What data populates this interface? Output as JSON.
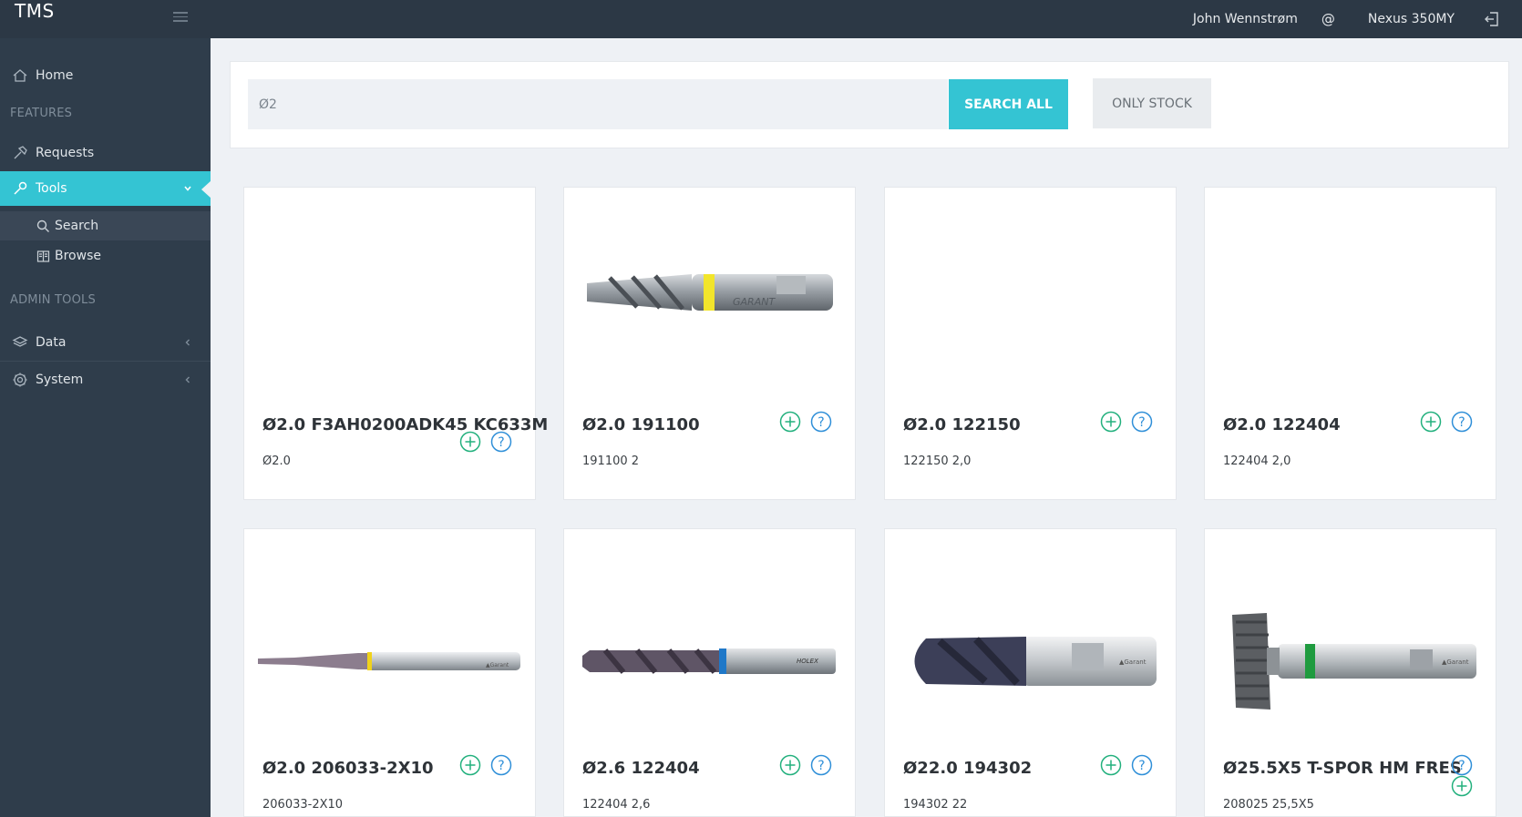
{
  "app": {
    "brand": "TMS"
  },
  "header": {
    "user": "John Wennstrøm",
    "at_symbol": "@",
    "site": "Nexus 350MY"
  },
  "sidebar": {
    "home": "Home",
    "section_features": "FEATURES",
    "requests": "Requests",
    "tools": "Tools",
    "tools_sub": {
      "search": "Search",
      "browse": "Browse"
    },
    "section_admin": "ADMIN TOOLS",
    "data": "Data",
    "system": "System"
  },
  "search": {
    "query": "Ø2",
    "search_all_label": "SEARCH ALL",
    "only_stock_label": "ONLY STOCK"
  },
  "colors": {
    "accent": "#34c4d3",
    "add_icon": "#22b07d",
    "help_icon": "#2f8fd8",
    "sidebar": "#2f3d4b",
    "topbar": "#2c3845"
  },
  "cards": [
    {
      "title": "Ø2.0 F3AH0200ADK45 KC633M",
      "subtitle": "Ø2.0",
      "image": "none"
    },
    {
      "title": "Ø2.0 191100",
      "subtitle": "191100 2",
      "image": "garant-endmill-yellow"
    },
    {
      "title": "Ø2.0 122150",
      "subtitle": "122150 2,0",
      "image": "none"
    },
    {
      "title": "Ø2.0 122404",
      "subtitle": "122404 2,0",
      "image": "none"
    },
    {
      "title": "Ø2.0 206033-2X10",
      "subtitle": "206033-2X10",
      "image": "micro-endmill"
    },
    {
      "title": "Ø2.6 122404",
      "subtitle": "122404 2,6",
      "image": "drill-blue-ring"
    },
    {
      "title": "Ø22.0 194302",
      "subtitle": "194302 22",
      "image": "ball-endmill"
    },
    {
      "title": "Ø25.5X5 T-SPOR HM FRES",
      "subtitle": "208025 25,5X5",
      "image": "t-slot-cutter"
    }
  ]
}
